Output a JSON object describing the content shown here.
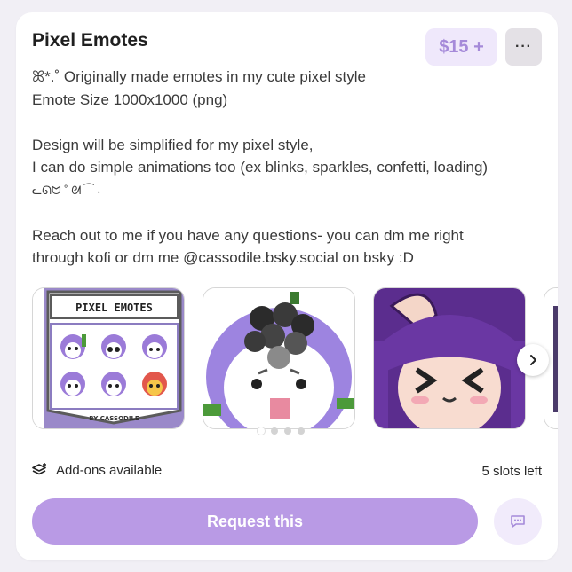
{
  "listing": {
    "title": "Pixel Emotes",
    "price": "$15 +",
    "more_label": "···",
    "description": [
      "ꕤ*.˚ Originally made emotes in my cute pixel style",
      "Emote Size 1000x1000 (png)",
      "",
      "Design will be simplified for my pixel style,",
      "I can do simple animations too (ex blinks, sparkles, confetti, loading)",
      "ᓚᘏᗢ ˚ ᘛ ⁀ ˖",
      "",
      "Reach out to me if you have any questions- you can dm me right",
      "through kofi or dm me @cassodile.bsky.social on bsky :D"
    ]
  },
  "gallery": {
    "sheet_title": "PIXEL EMOTES",
    "sheet_credit": "BY CASSODILE",
    "dot_count": 4,
    "active_dot": 0
  },
  "footer": {
    "addons_label": "Add-ons available",
    "slots_label": "5 slots left",
    "request_label": "Request this"
  },
  "icons": {
    "addons": "layers-plus-icon",
    "next": "chevron-right-icon",
    "chat": "chat-bubble-icon"
  },
  "colors": {
    "accent": "#b99ae5",
    "price_bg": "#efe8fb",
    "price_text": "#a58ad9",
    "chat_bg": "#f1ebfb"
  }
}
